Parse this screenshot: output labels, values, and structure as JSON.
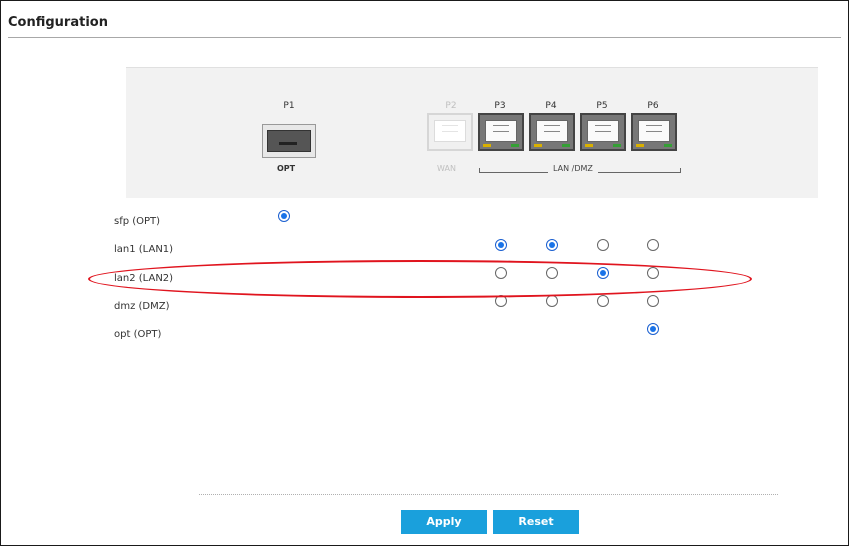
{
  "page": {
    "title": "Configuration"
  },
  "ports": [
    {
      "label": "P1",
      "sublabel": "OPT",
      "type": "sfp",
      "enabled": true
    },
    {
      "label": "P2",
      "sublabel": "WAN",
      "type": "rj45",
      "enabled": false
    },
    {
      "label": "P3",
      "type": "rj45",
      "enabled": true
    },
    {
      "label": "P4",
      "type": "rj45",
      "enabled": true
    },
    {
      "label": "P5",
      "type": "rj45",
      "enabled": true
    },
    {
      "label": "P6",
      "type": "rj45",
      "enabled": true
    }
  ],
  "group_label": "LAN /DMZ",
  "rows": [
    {
      "label": "sfp (OPT)",
      "selected": {
        "P1": true
      }
    },
    {
      "label": "lan1 (LAN1)",
      "selected": {
        "P3": true,
        "P4": true,
        "P5": false,
        "P6": false
      }
    },
    {
      "label": "lan2 (LAN2)",
      "selected": {
        "P3": false,
        "P4": false,
        "P5": true,
        "P6": false
      },
      "highlighted": true
    },
    {
      "label": "dmz (DMZ)",
      "selected": {
        "P3": false,
        "P4": false,
        "P5": false,
        "P6": false
      }
    },
    {
      "label": "opt (OPT)",
      "selected": {
        "P6": true
      }
    }
  ],
  "buttons": {
    "apply": "Apply",
    "reset": "Reset"
  },
  "colors": {
    "accent": "#1aa0dc",
    "radio_selected": "#1a73e8",
    "highlight": "#e0141e"
  }
}
